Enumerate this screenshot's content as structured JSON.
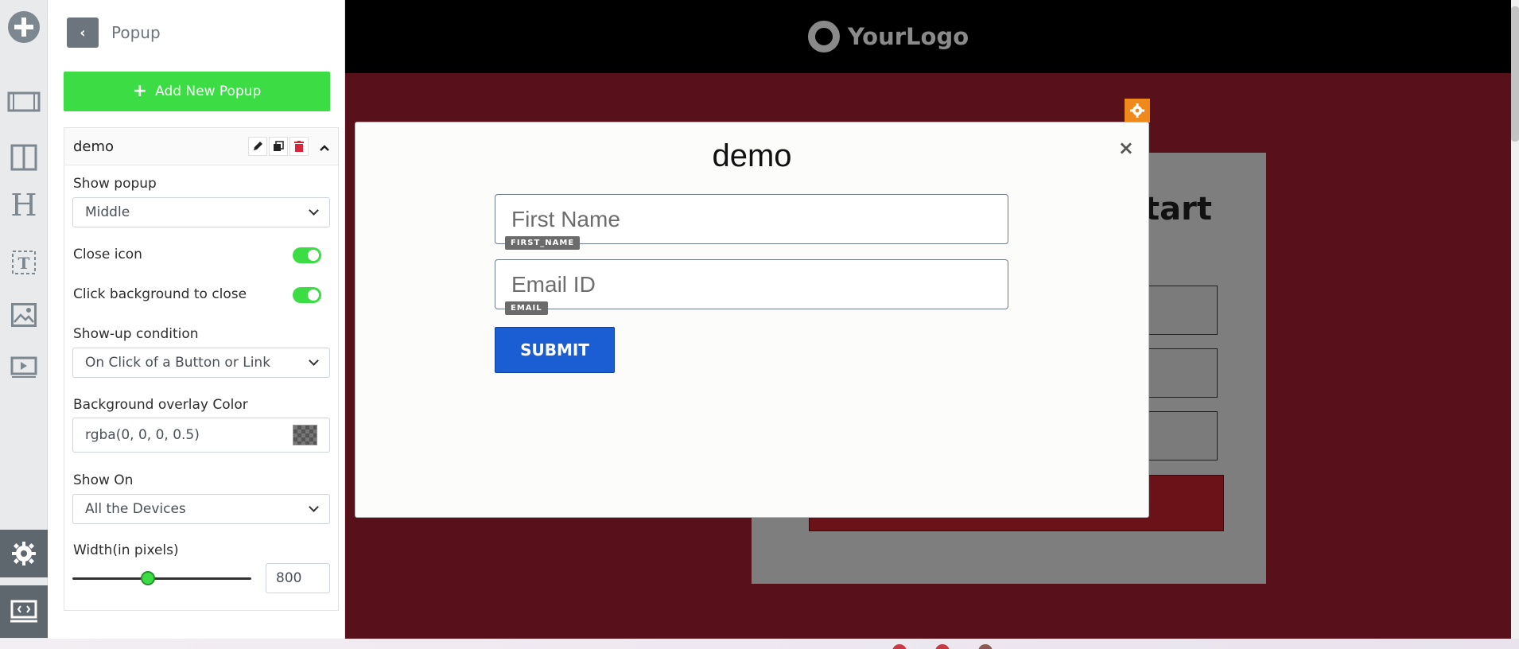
{
  "panel": {
    "title": "Popup",
    "add_button_label": "Add New Popup",
    "popup_name": "demo",
    "show_popup": {
      "label": "Show popup",
      "value": "Middle"
    },
    "close_icon": {
      "label": "Close icon",
      "on": true
    },
    "click_bg_close": {
      "label": "Click background to close",
      "on": true
    },
    "showup_condition": {
      "label": "Show-up condition",
      "value": "On Click of a Button or Link"
    },
    "overlay_color": {
      "label": "Background overlay Color",
      "value": "rgba(0, 0, 0, 0.5)"
    },
    "show_on": {
      "label": "Show On",
      "value": "All the Devices"
    },
    "width": {
      "label": "Width(in pixels)",
      "value": "800",
      "slider_fraction": 0.42
    }
  },
  "rail": {
    "icons": [
      "add-element-icon",
      "section-icon",
      "columns-icon",
      "heading-icon",
      "text-icon",
      "image-icon",
      "video-icon",
      "settings-icon",
      "code-icon"
    ]
  },
  "canvas": {
    "logo_text": "YourLogo",
    "bg_heading_fragment": "tart"
  },
  "modal": {
    "title": "demo",
    "close_symbol": "×",
    "first_name_placeholder": "First Name",
    "first_name_tag": "FIRST_NAME",
    "email_placeholder": "Email ID",
    "email_tag": "EMAIL",
    "submit_label": "SUBMIT"
  },
  "colors": {
    "accent_green": "#3cdc45",
    "canvas_bg": "#58111a",
    "submit_blue": "#1b5ed4",
    "gear_orange": "#f0891c"
  }
}
